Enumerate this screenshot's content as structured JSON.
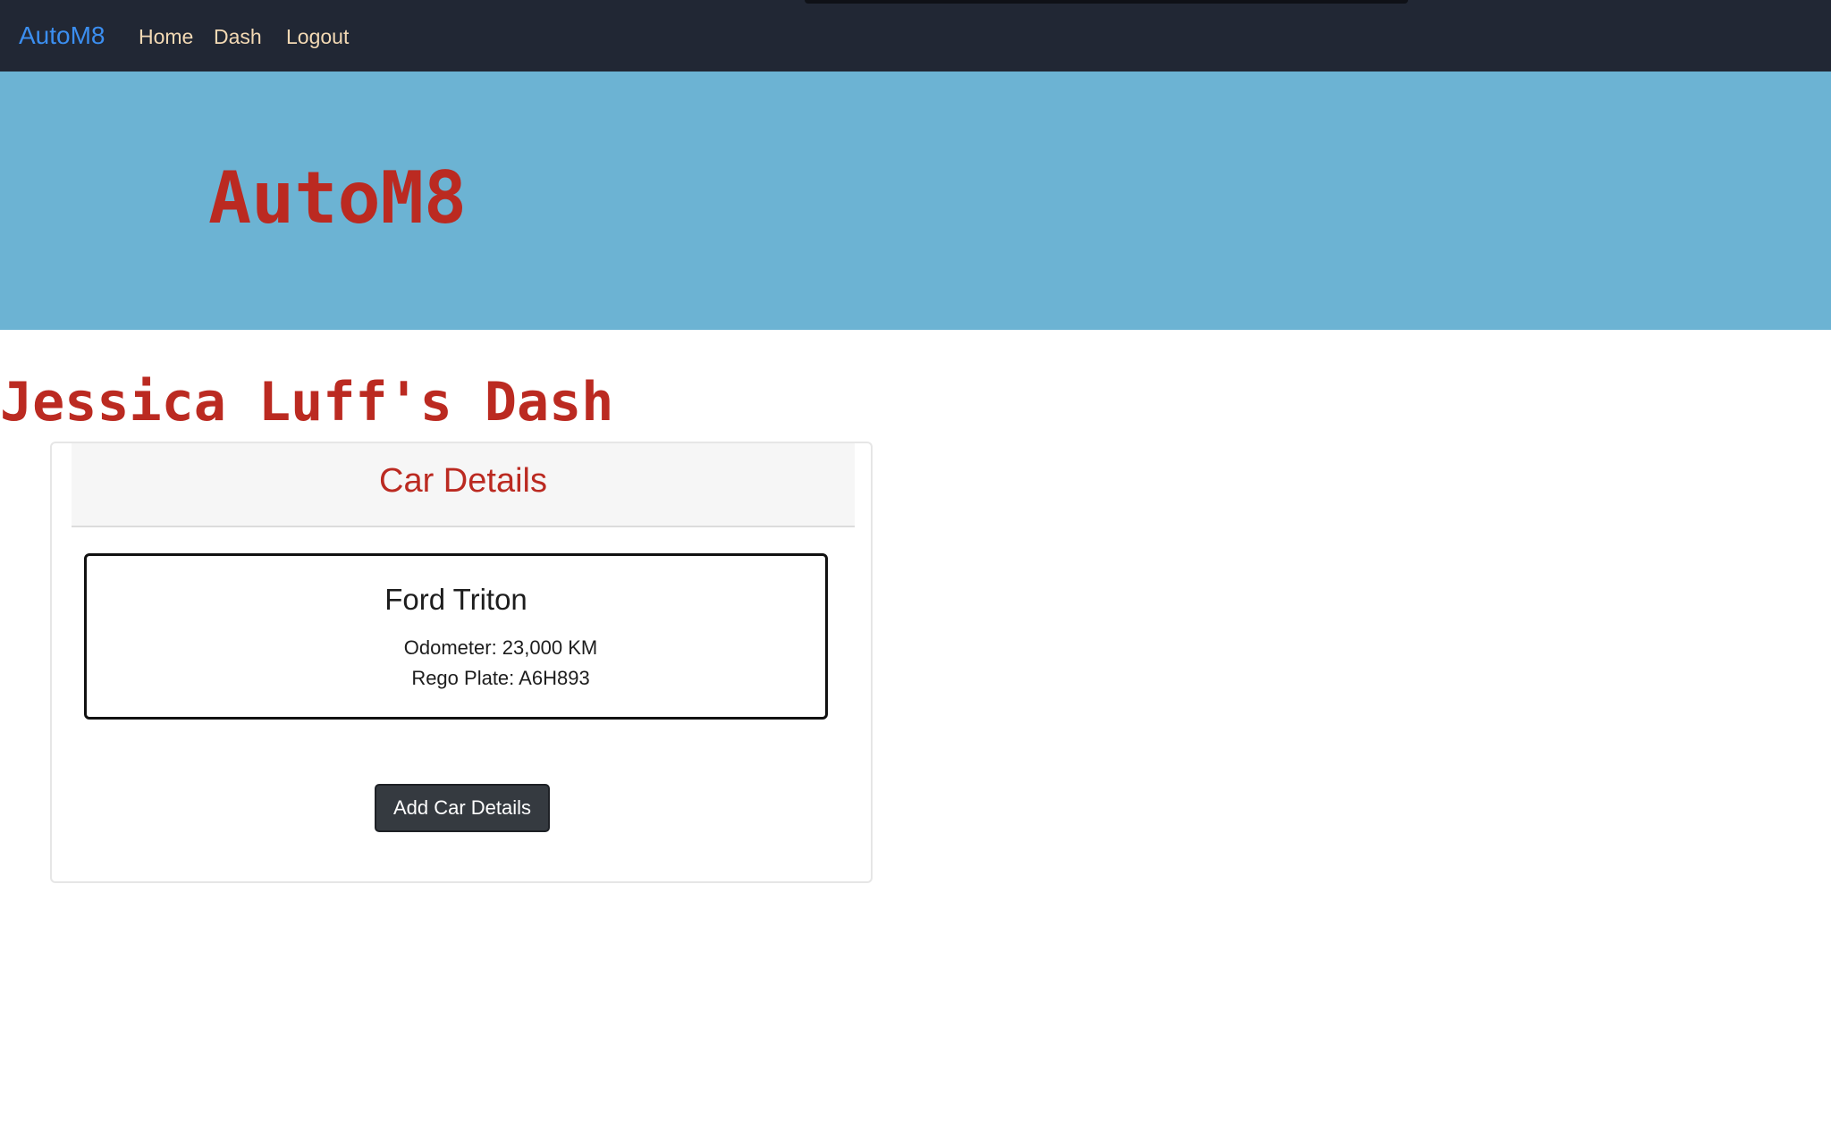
{
  "navbar": {
    "brand": "AutoM8",
    "links": [
      {
        "label": "Home"
      },
      {
        "label": "Dash"
      },
      {
        "label": "Logout"
      }
    ]
  },
  "hero": {
    "title": "AutoM8"
  },
  "dash": {
    "title": "Jessica Luff's Dash"
  },
  "car_card": {
    "header": "Car Details",
    "car": {
      "name": "Ford Triton",
      "odometer": "Odometer: 23,000 KM",
      "rego": "Rego Plate: A6H893"
    },
    "add_button": "Add Car Details"
  },
  "colors": {
    "navbar_bg": "#212734",
    "brand": "#3b8ef0",
    "nav_link": "#f3d9b4",
    "hero_bg": "#6cb3d3",
    "accent_red": "#bb2a21",
    "button_bg": "#353a40"
  }
}
